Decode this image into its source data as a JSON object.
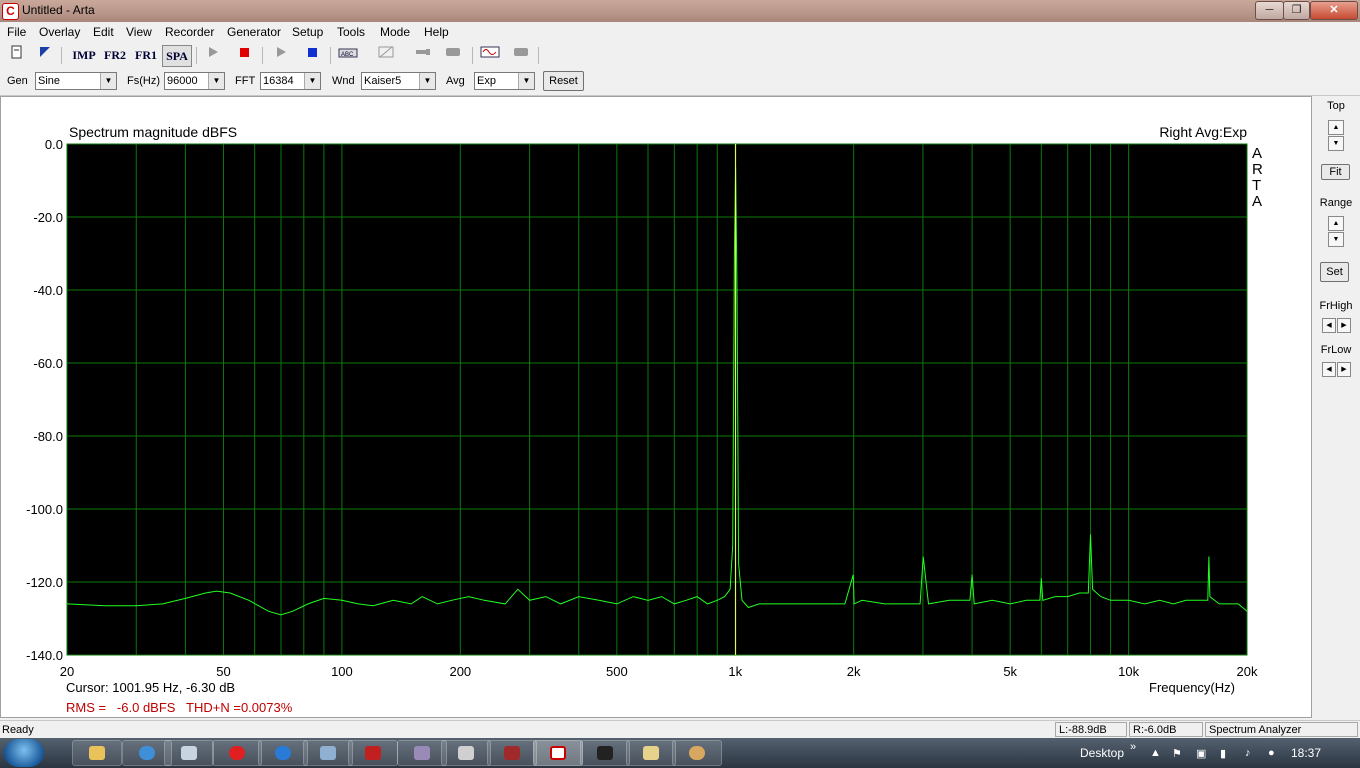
{
  "window": {
    "title": "Untitled - Arta",
    "icon_letter": "C",
    "minimize": "─",
    "maximize": "❐",
    "close": "✕"
  },
  "menu": [
    "File",
    "Overlay",
    "Edit",
    "View",
    "Recorder",
    "Generator",
    "Setup",
    "Tools",
    "Mode",
    "Help"
  ],
  "toolbar": {
    "imp": "IMP",
    "fr2": "FR2",
    "fr1": "FR1",
    "spa": "SPA"
  },
  "controls": {
    "gen_label": "Gen",
    "gen_value": "Sine",
    "fs_label": "Fs(Hz)",
    "fs_value": "96000",
    "fft_label": "FFT",
    "fft_value": "16384",
    "wnd_label": "Wnd",
    "wnd_value": "Kaiser5",
    "avg_label": "Avg",
    "avg_value": "Exp",
    "reset_label": "Reset"
  },
  "chart_data": {
    "type": "line",
    "title": "Spectrum magnitude dBFS",
    "channel_label": "Right Avg:Exp",
    "watermark": [
      "A",
      "R",
      "T",
      "A"
    ],
    "xlabel": "Frequency(Hz)",
    "x_scale": "log",
    "xlim": [
      20,
      20000
    ],
    "ylim": [
      -140,
      0
    ],
    "y_ticks": [
      "0.0",
      "-20.0",
      "-40.0",
      "-60.0",
      "-80.0",
      "-100.0",
      "-120.0",
      "-140.0"
    ],
    "x_ticks": [
      {
        "value": 20,
        "label": "20"
      },
      {
        "value": 50,
        "label": "50"
      },
      {
        "value": 100,
        "label": "100"
      },
      {
        "value": 200,
        "label": "200"
      },
      {
        "value": 500,
        "label": "500"
      },
      {
        "value": 1000,
        "label": "1k"
      },
      {
        "value": 2000,
        "label": "2k"
      },
      {
        "value": 5000,
        "label": "5k"
      },
      {
        "value": 10000,
        "label": "10k"
      },
      {
        "value": 20000,
        "label": "20k"
      }
    ],
    "grid": true,
    "colors": {
      "background": "#000000",
      "grid": "#0a7a0a",
      "trace": "#22ff22",
      "cursor": "#ffff66"
    },
    "cursor_freq_hz": 1001.95,
    "series": [
      {
        "x": [
          20,
          25,
          30,
          35,
          40,
          45,
          48,
          52,
          58,
          65,
          70,
          75,
          82,
          90,
          100,
          110,
          120,
          135,
          150,
          160,
          175,
          190,
          210,
          230,
          260,
          280,
          300,
          330,
          360,
          400,
          450,
          500,
          550,
          600,
          650,
          700,
          750,
          800,
          850,
          900,
          940,
          970,
          985,
          995,
          1002,
          1010,
          1020,
          1040,
          1080,
          1150,
          1300,
          1500,
          1700,
          1900,
          1995,
          2005,
          2100,
          2400,
          2700,
          2950,
          3005,
          3100,
          3500,
          3950,
          4000,
          4050,
          4500,
          5000,
          5500,
          5950,
          6000,
          6050,
          6500,
          7000,
          7500,
          7900,
          8000,
          8100,
          8500,
          9000,
          10000,
          11000,
          12000,
          13000,
          14000,
          15000,
          15900,
          16000,
          16100,
          17000,
          18000,
          19000,
          20000
        ],
        "y": [
          -126,
          -126.5,
          -126.5,
          -126,
          -124.5,
          -123,
          -122.5,
          -123,
          -125,
          -128,
          -129,
          -128,
          -126,
          -124.5,
          -125,
          -126,
          -126.5,
          -125,
          -126,
          -124,
          -126,
          -125,
          -124,
          -125,
          -126,
          -122,
          -125,
          -124,
          -126,
          -124,
          -125,
          -126,
          -124,
          -125,
          -124,
          -126,
          -125,
          -124,
          -126,
          -125,
          -124,
          -122,
          -110,
          -30,
          -6.3,
          -40,
          -115,
          -125,
          -127,
          -126,
          -126,
          -126,
          -126,
          -126,
          -118,
          -126,
          -125,
          -126,
          -126,
          -126,
          -113,
          -126,
          -125,
          -125,
          -118,
          -126,
          -125,
          -126,
          -125,
          -125,
          -119,
          -125,
          -124,
          -124,
          -123,
          -123,
          -107,
          -122,
          -124,
          -125,
          -125,
          -126,
          -125,
          -126,
          -125,
          -125,
          -125,
          -113,
          -124,
          -126,
          -126,
          -126,
          -128
        ]
      }
    ]
  },
  "readouts": {
    "cursor": "Cursor: 1001.95 Hz, -6.30 dB",
    "rms": "RMS =   -6.0 dBFS   THD+N =0.0073%"
  },
  "right_panel": {
    "top": "Top",
    "fit": "Fit",
    "range": "Range",
    "set": "Set",
    "frhigh": "FrHigh",
    "frlow": "FrLow"
  },
  "status": {
    "ready": "Ready",
    "left": "L:-88.9dB",
    "right": "R:-6.0dB",
    "mode": "Spectrum Analyzer"
  },
  "taskbar": {
    "desktop": "Desktop",
    "chevron": "»",
    "time": "18:37"
  }
}
